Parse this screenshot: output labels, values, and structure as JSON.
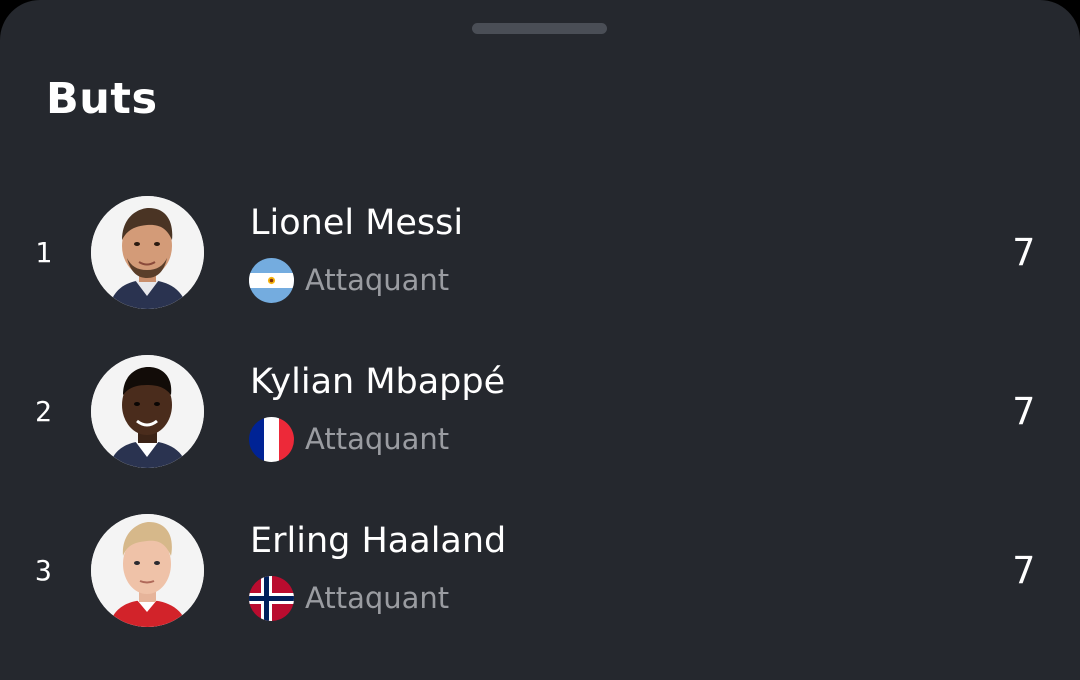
{
  "sheet": {
    "title": "Buts",
    "background": "#25282e"
  },
  "players": [
    {
      "rank": "1",
      "name": "Lionel Messi",
      "position": "Attaquant",
      "country_flag": "argentina-flag-icon",
      "avatar": "player-photo-messi",
      "value": "7"
    },
    {
      "rank": "2",
      "name": "Kylian Mbappé",
      "position": "Attaquant",
      "country_flag": "france-flag-icon",
      "avatar": "player-photo-mbappe",
      "value": "7"
    },
    {
      "rank": "3",
      "name": "Erling Haaland",
      "position": "Attaquant",
      "country_flag": "norway-flag-icon",
      "avatar": "player-photo-haaland",
      "value": "7"
    }
  ]
}
